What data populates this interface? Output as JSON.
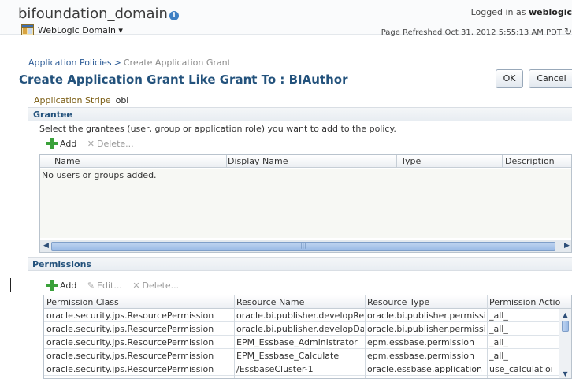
{
  "header": {
    "domain_title": "bifoundation_domain",
    "domain_menu_label": "WebLogic Domain",
    "logged_in_prefix": "Logged in as",
    "logged_in_user": "weblogic",
    "page_refreshed": "Page Refreshed Oct 31, 2012 5:55:13 AM PDT"
  },
  "breadcrumb": {
    "parent": "Application Policies",
    "separator": ">",
    "current": "Create Application Grant"
  },
  "page_title": "Create Application Grant Like Grant To : BIAuthor",
  "buttons": {
    "ok": "OK",
    "cancel": "Cancel"
  },
  "application_stripe": {
    "label": "Application Stripe",
    "value": "obi"
  },
  "grantee": {
    "title": "Grantee",
    "description": "Select the grantees (user, group or application role) you want to add to the policy.",
    "toolbar": {
      "add": "Add",
      "delete": "Delete..."
    },
    "columns": [
      "Name",
      "Display Name",
      "Type",
      "Description"
    ],
    "empty_message": "No users or groups added."
  },
  "permissions": {
    "title": "Permissions",
    "toolbar": {
      "add": "Add",
      "edit": "Edit...",
      "delete": "Delete..."
    },
    "columns": [
      "Permission Class",
      "Resource Name",
      "Resource Type",
      "Permission Action"
    ],
    "rows": [
      [
        "oracle.security.jps.ResourcePermission",
        "oracle.bi.publisher.developRepo",
        "oracle.bi.publisher.permission",
        "_all_"
      ],
      [
        "oracle.security.jps.ResourcePermission",
        "oracle.bi.publisher.developDatal",
        "oracle.bi.publisher.permission",
        "_all_"
      ],
      [
        "oracle.security.jps.ResourcePermission",
        "EPM_Essbase_Administrator",
        "epm.essbase.permission",
        "_all_"
      ],
      [
        "oracle.security.jps.ResourcePermission",
        "EPM_Essbase_Calculate",
        "epm.essbase.permission",
        "_all_"
      ],
      [
        "oracle.security.jps.ResourcePermission",
        "/EssbaseCluster-1",
        "oracle.essbase.application",
        "use_calculation"
      ]
    ]
  }
}
